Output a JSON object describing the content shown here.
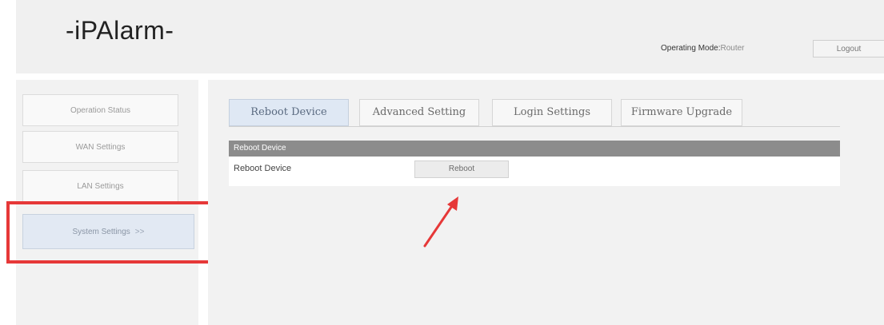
{
  "header": {
    "logo": "-iPAlarm-",
    "operating_mode_label": "Operating Mode:",
    "operating_mode_value": "Router",
    "logout_label": "Logout"
  },
  "sidebar": {
    "items": [
      {
        "label": "Operation Status",
        "active": false
      },
      {
        "label": "WAN Settings",
        "active": false
      },
      {
        "label": "LAN Settings",
        "active": false
      },
      {
        "label": "System Settings",
        "active": true
      }
    ],
    "active_arrow": ">>"
  },
  "tabs": [
    {
      "label": "Reboot Device",
      "active": true
    },
    {
      "label": "Advanced Setting",
      "active": false
    },
    {
      "label": "Login Settings",
      "active": false
    },
    {
      "label": "Firmware Upgrade",
      "active": false
    }
  ],
  "section": {
    "title": "Reboot Device",
    "row_label": "Reboot Device",
    "button_label": "Reboot"
  },
  "colors": {
    "highlight": "#e63838",
    "section_header": "#8c8c8c",
    "active_tab": "#dfe8f4"
  }
}
